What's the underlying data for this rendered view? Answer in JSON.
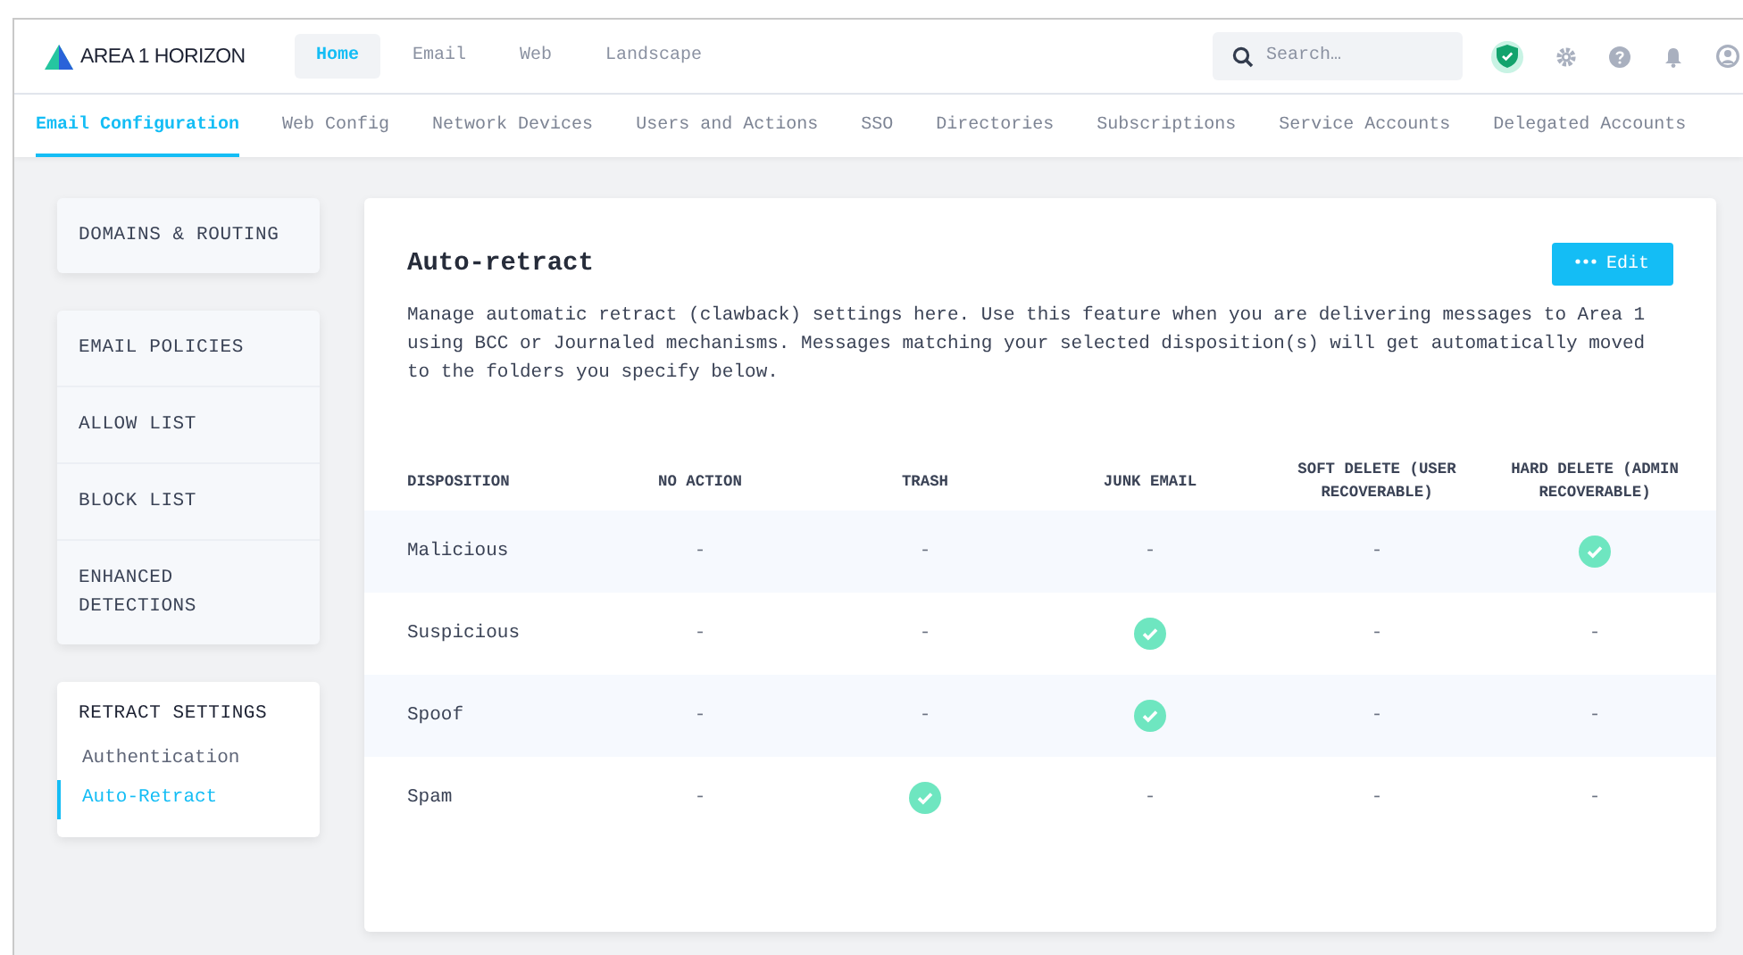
{
  "brand": "AREA 1 HORIZON",
  "top_nav": [
    {
      "label": "Home",
      "selected": true
    },
    {
      "label": "Email",
      "selected": false
    },
    {
      "label": "Web",
      "selected": false
    },
    {
      "label": "Landscape",
      "selected": false
    }
  ],
  "search": {
    "placeholder": "Search…"
  },
  "sub_nav": [
    {
      "label": "Email Configuration",
      "selected": true
    },
    {
      "label": "Web Config",
      "selected": false
    },
    {
      "label": "Network Devices",
      "selected": false
    },
    {
      "label": "Users and Actions",
      "selected": false
    },
    {
      "label": "SSO",
      "selected": false
    },
    {
      "label": "Directories",
      "selected": false
    },
    {
      "label": "Subscriptions",
      "selected": false
    },
    {
      "label": "Service Accounts",
      "selected": false
    },
    {
      "label": "Delegated Accounts",
      "selected": false
    }
  ],
  "sidebar": [
    {
      "kind": "menu",
      "items": [
        {
          "label": "DOMAINS & ROUTING"
        }
      ]
    },
    {
      "kind": "menu",
      "items": [
        {
          "label": "EMAIL POLICIES"
        },
        {
          "label": "ALLOW LIST"
        },
        {
          "label": "BLOCK LIST"
        },
        {
          "label": "ENHANCED DETECTIONS"
        }
      ]
    },
    {
      "kind": "section",
      "title": "RETRACT SETTINGS",
      "items": [
        {
          "label": "Authentication",
          "selected": false
        },
        {
          "label": "Auto-Retract",
          "selected": true
        }
      ]
    }
  ],
  "panel": {
    "title": "Auto-retract",
    "edit_button": "Edit",
    "description": "Manage automatic retract (clawback) settings here. Use this feature when you are delivering messages to Area 1 using BCC or Journaled mechanisms. Messages matching your selected disposition(s) will get automatically moved to the folders you specify below.",
    "table": {
      "columns": [
        "DISPOSITION",
        "NO ACTION",
        "TRASH",
        "JUNK EMAIL",
        "SOFT DELETE (USER RECOVERABLE)",
        "HARD DELETE (ADMIN RECOVERABLE)"
      ],
      "rows": [
        {
          "cells": [
            {
              "kind": "label",
              "text": "Malicious"
            },
            {
              "kind": "mark",
              "checked": false,
              "text": "-"
            },
            {
              "kind": "mark",
              "checked": false,
              "text": "-"
            },
            {
              "kind": "mark",
              "checked": false,
              "text": "-"
            },
            {
              "kind": "mark",
              "checked": false,
              "text": "-"
            },
            {
              "kind": "mark",
              "checked": true
            }
          ]
        },
        {
          "cells": [
            {
              "kind": "label",
              "text": "Suspicious"
            },
            {
              "kind": "mark",
              "checked": false,
              "text": "-"
            },
            {
              "kind": "mark",
              "checked": false,
              "text": "-"
            },
            {
              "kind": "mark",
              "checked": true
            },
            {
              "kind": "mark",
              "checked": false,
              "text": "-"
            },
            {
              "kind": "mark",
              "checked": false,
              "text": "-"
            }
          ]
        },
        {
          "cells": [
            {
              "kind": "label",
              "text": "Spoof"
            },
            {
              "kind": "mark",
              "checked": false,
              "text": "-"
            },
            {
              "kind": "mark",
              "checked": false,
              "text": "-"
            },
            {
              "kind": "mark",
              "checked": true
            },
            {
              "kind": "mark",
              "checked": false,
              "text": "-"
            },
            {
              "kind": "mark",
              "checked": false,
              "text": "-"
            }
          ]
        },
        {
          "cells": [
            {
              "kind": "label",
              "text": "Spam"
            },
            {
              "kind": "mark",
              "checked": false,
              "text": "-"
            },
            {
              "kind": "mark",
              "checked": true
            },
            {
              "kind": "mark",
              "checked": false,
              "text": "-"
            },
            {
              "kind": "mark",
              "checked": false,
              "text": "-"
            },
            {
              "kind": "mark",
              "checked": false,
              "text": "-"
            }
          ]
        }
      ]
    }
  }
}
